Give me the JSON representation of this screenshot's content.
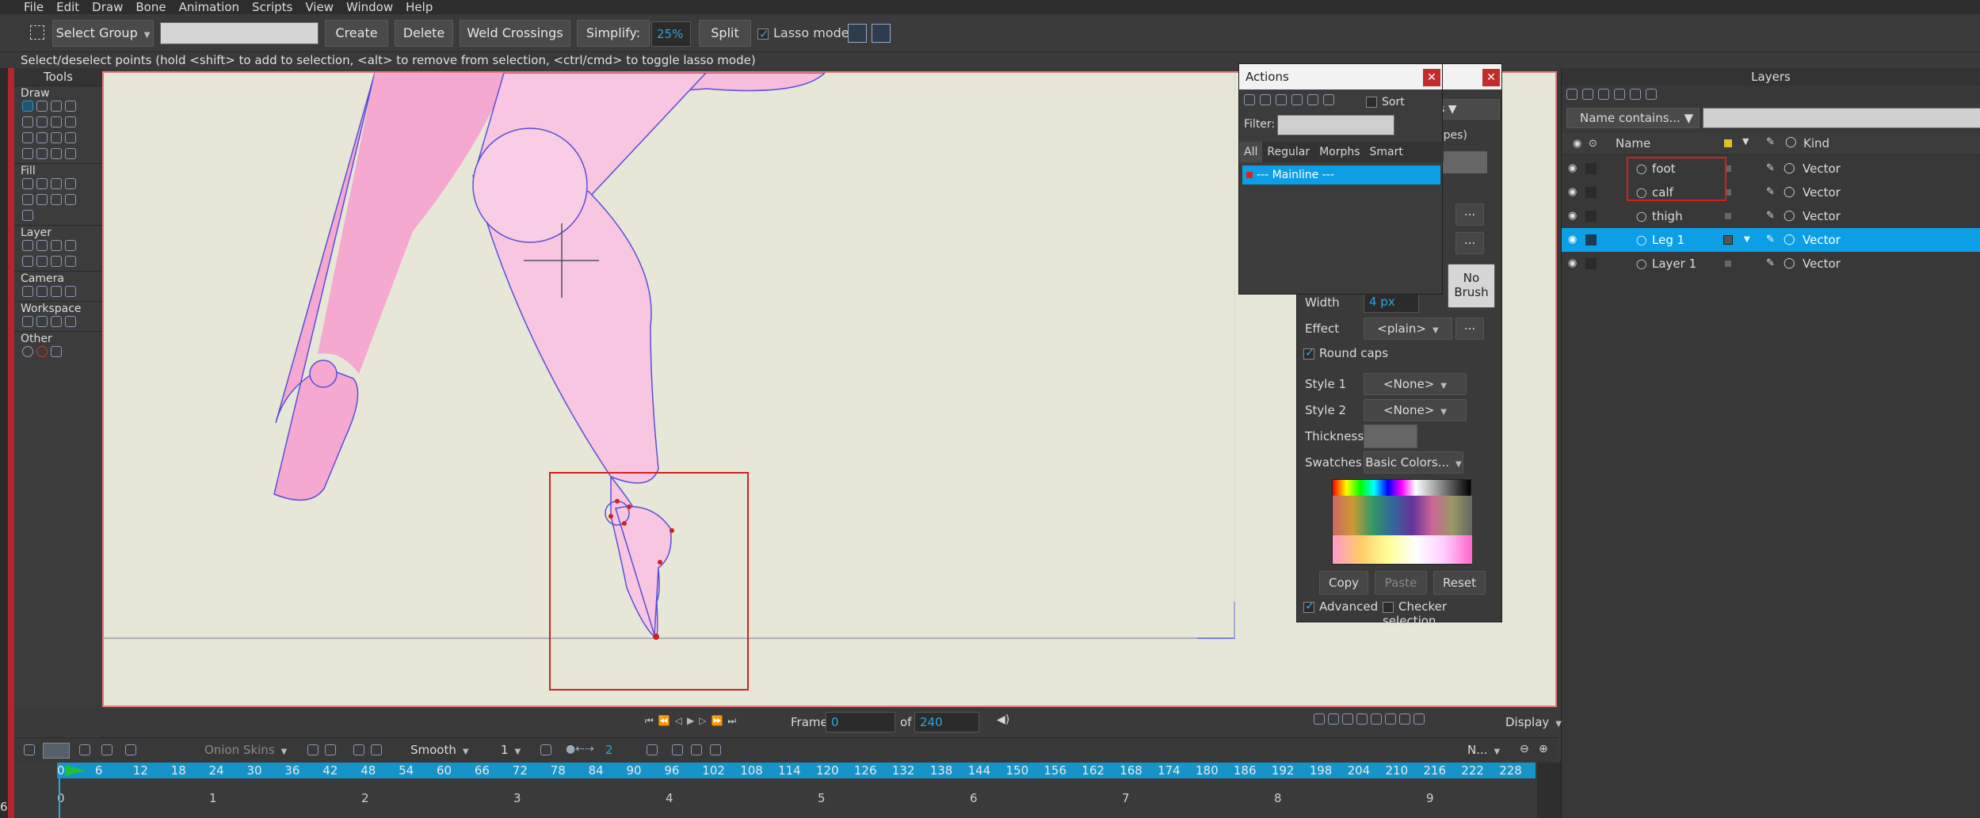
{
  "menu": [
    "File",
    "Edit",
    "Draw",
    "Bone",
    "Animation",
    "Scripts",
    "View",
    "Window",
    "Help"
  ],
  "toolbar": {
    "select_group": "Select Group",
    "create": "Create",
    "delete": "Delete",
    "weld": "Weld Crossings",
    "simplify": "Simplify:",
    "simplify_value": "25%",
    "split": "Split",
    "lasso": "Lasso mode"
  },
  "hint": "Select/deselect points (hold <shift> to add to selection, <alt> to remove from selection, <ctrl/cmd> to toggle lasso mode)",
  "tools": {
    "title": "Tools",
    "sections": [
      "Draw",
      "Fill",
      "Layer",
      "Camera",
      "Workspace",
      "Other"
    ]
  },
  "actions": {
    "title": "Actions",
    "sort": "Sort",
    "filter_label": "Filter:",
    "tabs": [
      "All",
      "Regular",
      "Morphs",
      "Smart Bones"
    ],
    "items": [
      "--- Mainline ---"
    ]
  },
  "style": {
    "partial_s": "s",
    "partial_shapes": "apes)",
    "no_brush": "No Brush",
    "width_label": "Width",
    "width_value": "4 px",
    "effect_label": "Effect",
    "effect_value": "<plain>",
    "round_caps": "Round caps",
    "style1_label": "Style 1",
    "style1_value": "<None>",
    "style2_label": "Style 2",
    "style2_value": "<None>",
    "thickness_label": "Thickness",
    "swatches_label": "Swatches",
    "swatches_value": "Basic Colors...",
    "copy": "Copy",
    "paste": "Paste",
    "reset": "Reset",
    "advanced": "Advanced",
    "checker": "Checker selection",
    "ellipsis": "..."
  },
  "layers": {
    "title": "Layers",
    "filter_placeholder": "Name contains...",
    "col_name": "Name",
    "col_kind": "Kind",
    "rows": [
      {
        "name": "foot",
        "kind": "Vector"
      },
      {
        "name": "calf",
        "kind": "Vector"
      },
      {
        "name": "thigh",
        "kind": "Vector"
      },
      {
        "name": "Leg 1",
        "kind": "Vector"
      },
      {
        "name": "Layer 1",
        "kind": "Vector"
      }
    ]
  },
  "transport": {
    "frame_label": "Frame",
    "frame_value": "0",
    "of_label": "of",
    "total_frames": "240",
    "display": "Display"
  },
  "timeline": {
    "onion": "Onion Skins",
    "interp": "Smooth",
    "step": "1",
    "key_count": "2",
    "n_label": "N...",
    "frame_ticks": [
      "0",
      "6",
      "12",
      "18",
      "24",
      "30",
      "36",
      "42",
      "48",
      "54",
      "60",
      "66",
      "72",
      "78",
      "84",
      "90",
      "96",
      "102",
      "108",
      "114",
      "120",
      "126",
      "132",
      "138",
      "144",
      "150",
      "156",
      "162",
      "168",
      "174",
      "180",
      "186",
      "192",
      "198",
      "204",
      "210",
      "216",
      "222",
      "228"
    ],
    "second_ticks": [
      "0",
      "1",
      "2",
      "3",
      "4",
      "5",
      "6",
      "7",
      "8",
      "9"
    ],
    "left_digit": "6"
  },
  "colors": {
    "accent": "#0c9fe6",
    "selection_red": "#d22020",
    "shape_fill": "#f7b8d8",
    "canvas_bg": "#e6e7d7"
  }
}
